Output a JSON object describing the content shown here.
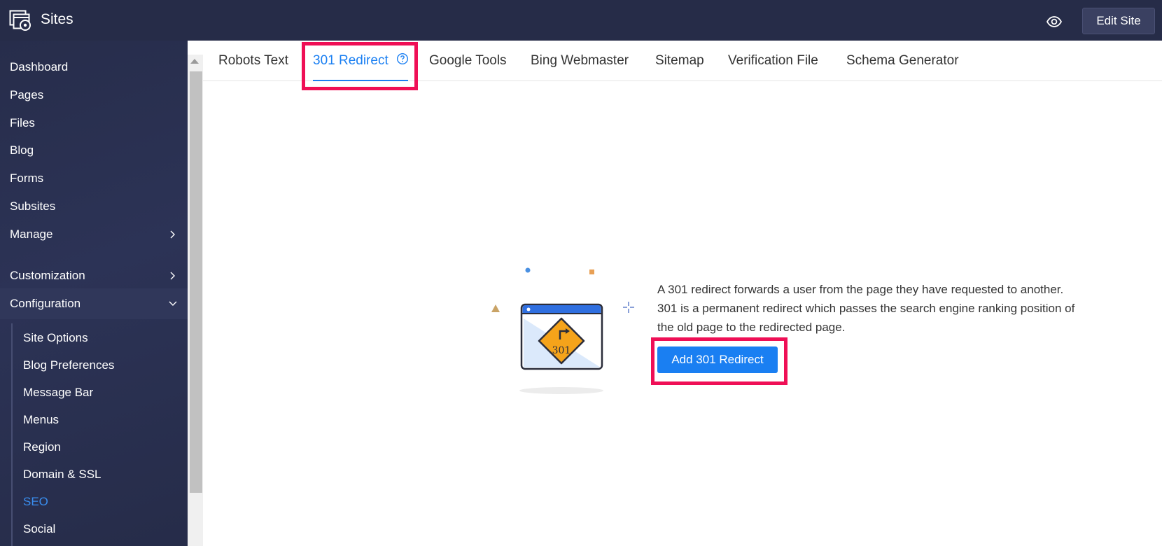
{
  "header": {
    "app_title": "Sites",
    "app_icon": "sites-icon",
    "preview_icon": "eye-icon",
    "edit_site_label": "Edit Site"
  },
  "sidebar": {
    "items": [
      {
        "label": "Dashboard"
      },
      {
        "label": "Pages"
      },
      {
        "label": "Files"
      },
      {
        "label": "Blog"
      },
      {
        "label": "Forms"
      },
      {
        "label": "Subsites"
      },
      {
        "label": "Manage",
        "icon": "chevron-right-icon"
      },
      {
        "label": "Customization",
        "icon": "chevron-right-icon"
      },
      {
        "label": "Configuration",
        "icon": "chevron-down-icon",
        "expanded": true
      }
    ],
    "configuration_items": [
      {
        "label": "Site Options"
      },
      {
        "label": "Blog Preferences"
      },
      {
        "label": "Message Bar"
      },
      {
        "label": "Menus"
      },
      {
        "label": "Region"
      },
      {
        "label": "Domain & SSL"
      },
      {
        "label": "SEO",
        "active": true
      },
      {
        "label": "Social"
      }
    ]
  },
  "tabs": {
    "items": [
      {
        "label": "Robots Text"
      },
      {
        "label": "301 Redirect",
        "active": true
      },
      {
        "label": "Google Tools"
      },
      {
        "label": "Bing Webmaster"
      },
      {
        "label": "Sitemap"
      },
      {
        "label": "Verification File"
      },
      {
        "label": "Schema Generator"
      }
    ],
    "help_icon": "question-circle-icon"
  },
  "main": {
    "illustration_sign_text": "301",
    "description": "A 301 redirect forwards a user from the page they have requested to another. 301 is a permanent redirect which passes the search engine ranking position of the old page to the redirected page.",
    "add_button_label": "Add 301 Redirect"
  },
  "colors": {
    "topbar_bg": "#262c48",
    "sidebar_bg": "#2a3050",
    "accent": "#1a7ff2",
    "annotation": "#ef0f56",
    "sign": "#f5a31a"
  }
}
